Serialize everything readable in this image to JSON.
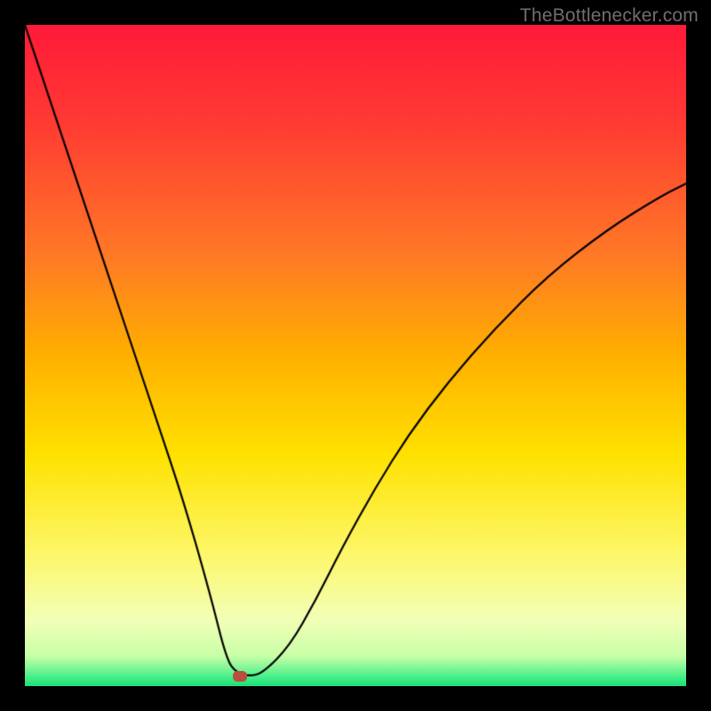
{
  "watermark": {
    "text": "TheBottlenecker.com"
  },
  "colors": {
    "page_bg": "#000000",
    "curve": "#000000",
    "marker": "#b94e3d",
    "gradient_stops": [
      {
        "offset": 0.0,
        "color": "#ff1a3a"
      },
      {
        "offset": 0.15,
        "color": "#ff3b33"
      },
      {
        "offset": 0.35,
        "color": "#ff7a26"
      },
      {
        "offset": 0.5,
        "color": "#ffb000"
      },
      {
        "offset": 0.65,
        "color": "#ffe200"
      },
      {
        "offset": 0.8,
        "color": "#fdf76a"
      },
      {
        "offset": 0.9,
        "color": "#f3ffb7"
      },
      {
        "offset": 0.955,
        "color": "#c8ffa7"
      },
      {
        "offset": 0.985,
        "color": "#4df08a"
      },
      {
        "offset": 1.0,
        "color": "#19e07a"
      }
    ]
  },
  "chart_data": {
    "type": "line",
    "title": "",
    "xlabel": "",
    "ylabel": "",
    "xlim": [
      0,
      1
    ],
    "ylim": [
      0,
      1
    ],
    "series": [
      {
        "name": "curve",
        "x": [
          0.0,
          0.04,
          0.08,
          0.12,
          0.16,
          0.2,
          0.24,
          0.28,
          0.305,
          0.32,
          0.34,
          0.36,
          0.4,
          0.44,
          0.48,
          0.53,
          0.58,
          0.64,
          0.71,
          0.79,
          0.88,
          0.96,
          1.0
        ],
        "y": [
          1.0,
          0.88,
          0.76,
          0.64,
          0.52,
          0.4,
          0.28,
          0.14,
          0.04,
          0.02,
          0.015,
          0.02,
          0.06,
          0.13,
          0.21,
          0.3,
          0.38,
          0.46,
          0.54,
          0.62,
          0.69,
          0.74,
          0.76
        ]
      }
    ],
    "marker": {
      "x": 0.325,
      "y": 0.015
    }
  }
}
